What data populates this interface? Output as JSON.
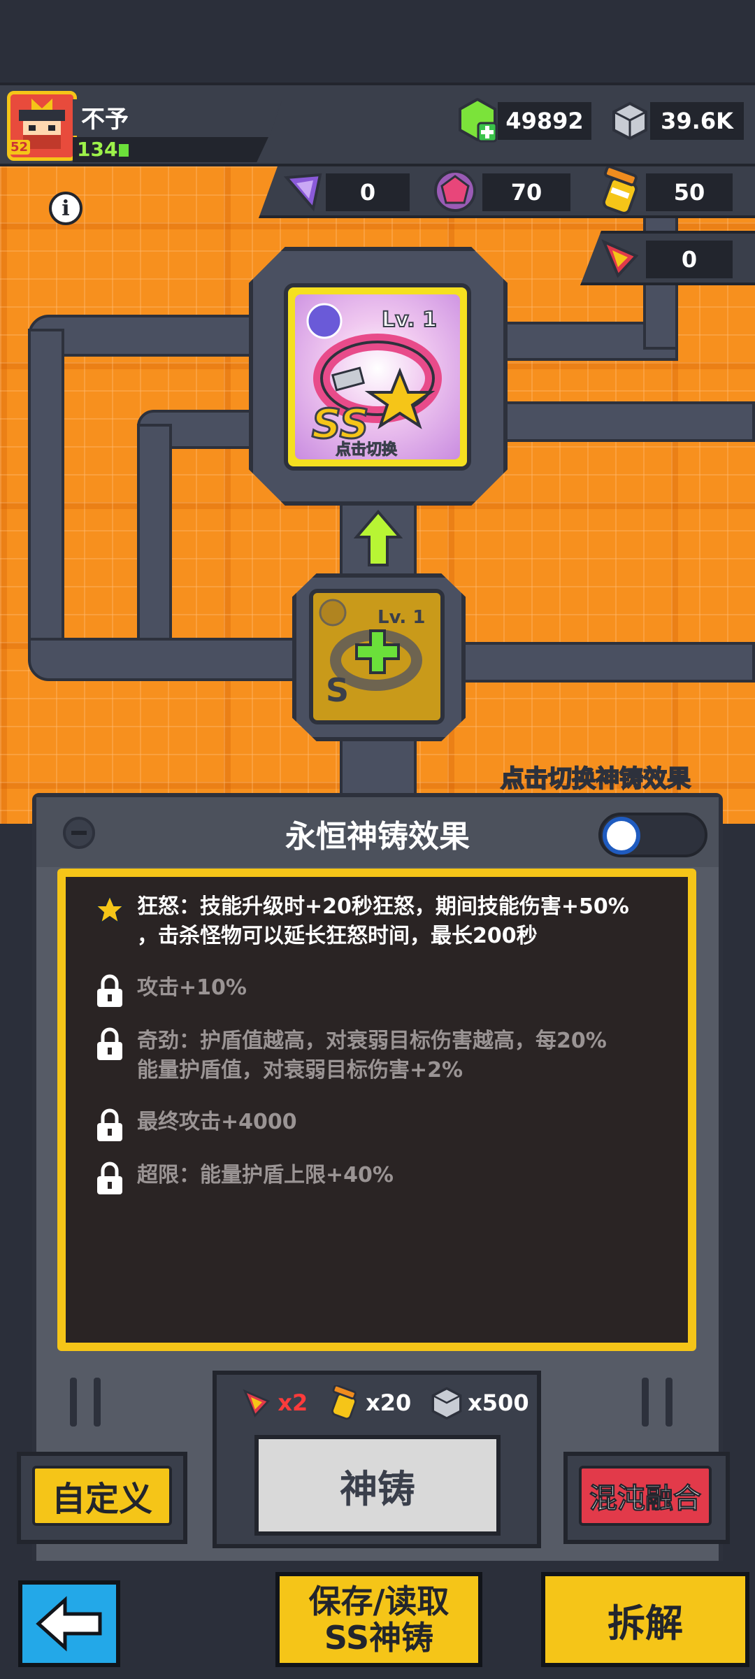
{
  "player": {
    "name": "不予",
    "level": "134",
    "avatar_badge": "52"
  },
  "currencies": {
    "gems": "49892",
    "cubes": "39.6K",
    "purple_crystal": "0",
    "pink_orb": "70",
    "forge_hammer": "50",
    "red_ticket": "0"
  },
  "upper_card": {
    "level": "Lv. 1",
    "grade": "SS",
    "tap_hint": "点击切换"
  },
  "lower_card": {
    "level": "Lv. 1",
    "grade": "S"
  },
  "switch_effect_label": "点击切换神铸效果",
  "panel": {
    "title": "永恒神铸效果",
    "effects": [
      {
        "text": "狂怒：技能升级时+20秒狂怒，期间技能伤害+50%，击杀怪物可以延长狂怒时间，最长200秒",
        "line1": "狂怒：技能升级时+20秒狂怒，期间技能伤害+50%",
        "line2": "，击杀怪物可以延长狂怒时间，最长200秒",
        "icon": "star-icon",
        "locked": false
      },
      {
        "line1": "攻击+10%",
        "line2": "",
        "icon": "lock-icon",
        "locked": true
      },
      {
        "line1": "奇劲：护盾值越高，对衰弱目标伤害越高，每20%",
        "line2": "能量护盾值，对衰弱目标伤害+2%",
        "icon": "lock-icon",
        "locked": true
      },
      {
        "line1": "最终攻击+4000",
        "line2": "",
        "icon": "lock-icon",
        "locked": true
      },
      {
        "line1": "超限：能量护盾上限+40%",
        "line2": "",
        "icon": "lock-icon",
        "locked": true
      }
    ]
  },
  "cost": {
    "red_ticket": "x2",
    "forge_hammer": "x20",
    "cubes": "x500"
  },
  "buttons": {
    "forge": "神铸",
    "custom": "自定义",
    "chaos_fusion": "混沌融合",
    "save_load_line1": "保存/读取",
    "save_load_line2": "SS神铸",
    "dismantle": "拆解"
  },
  "colors": {
    "board_orange": "#f7901e",
    "accent_yellow": "#f5c518",
    "chaos_red": "#e23a4a",
    "back_blue": "#23a8e8",
    "cost_red": "#ff3b3b"
  }
}
